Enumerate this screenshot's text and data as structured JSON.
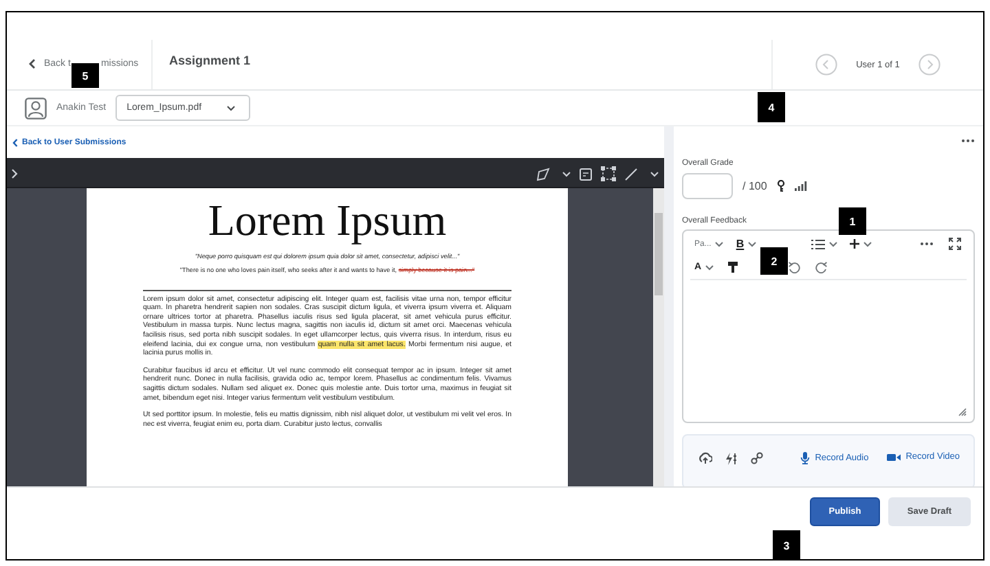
{
  "header": {
    "back_link": {
      "parts": [
        "Back t",
        "missions"
      ]
    },
    "title": "Assignment 1",
    "pager": {
      "label": "User 1 of 1"
    }
  },
  "student": {
    "name": "Anakin Test",
    "file_select": {
      "value": "Lorem_Ipsum.pdf"
    }
  },
  "back_to_user_submissions": "Back to User Submissions",
  "document": {
    "title": "Lorem Ipsum",
    "quotes": [
      {
        "italic": true,
        "segments": [
          {
            "text": "\"Neque porro quisquam est qui dolorem ipsum quia dolor sit amet, consectetur, adipisci velit...\"",
            "struck": false
          }
        ]
      },
      {
        "italic": false,
        "segments": [
          {
            "text": "\"There is no one who loves pain itself, who seeks after it and wants to have it, ",
            "struck": false
          },
          {
            "text": "simply because it is pain...\"",
            "struck": true
          }
        ]
      }
    ],
    "paragraphs": [
      {
        "segments": [
          {
            "text": "Lorem ipsum dolor sit amet, consectetur adipiscing elit. Integer quam est, facilisis vitae urna non, tempor efficitur quam. In pharetra hendrerit sapien non sodales. Cras suscipit dictum ligula, et viverra ipsum viverra et. Aliquam ornare ultrices tortor at pharetra. Phasellus iaculis risus sed ligula placerat, sit amet vehicula purus efficitur. Vestibulum in massa turpis. Nunc lectus magna, sagittis non iaculis id, dictum sit amet orci. Maecenas vehicula facilisis risus, sed porta nibh suscipit sodales. In eget ullamcorper lectus, quis viverra risus. In interdum, risus eu eleifend lacinia, dui ex congue urna, non vestibulum ",
            "highlighted": false
          },
          {
            "text": "quam nulla sit amet lacus.",
            "highlighted": true
          },
          {
            "text": " Morbi fermentum nisi augue, et lacinia purus mollis in.",
            "highlighted": false
          }
        ]
      },
      {
        "segments": [
          {
            "text": "Curabitur faucibus id arcu et efficitur. Ut vel nunc commodo elit consequat tempor ac in ipsum. Integer sit amet hendrerit nunc. Donec in nulla facilisis, gravida odio ac, tempor lorem. Phasellus ac condimentum felis. Vivamus sagittis dictum sodales. Nullam sed aliquet ex. Donec quis molestie ante. Duis tortor urna, maximus in feugiat sit amet, bibendum eget nisi. Integer varius fermentum velit vestibulum vestibulum.",
            "highlighted": false
          }
        ]
      },
      {
        "segments": [
          {
            "text": "Ut sed porttitor ipsum. In molestie, felis eu mattis dignissim, nibh nisl aliquet dolor, ut vestibulum mi velit vel eros. In nec est viverra, feugiat enim eu, porta diam. Curabitur justo lectus, convallis",
            "highlighted": false
          }
        ]
      }
    ]
  },
  "grading": {
    "grade_label": "Overall Grade",
    "grade_max": "/ 100",
    "feedback_label": "Overall Feedback",
    "editor": {
      "format_dropdown": "Pa...",
      "bold_glyph": "B",
      "text_style_glyph": "A"
    },
    "record_buttons": [
      {
        "kind": "audio",
        "label": "Record Audio"
      },
      {
        "kind": "video",
        "label": "Record Video"
      }
    ]
  },
  "actions": [
    {
      "label": "Publish",
      "primary": true
    },
    {
      "label": "Save Draft",
      "primary": false
    }
  ],
  "callouts": [
    "1",
    "2",
    "3",
    "4",
    "5"
  ]
}
